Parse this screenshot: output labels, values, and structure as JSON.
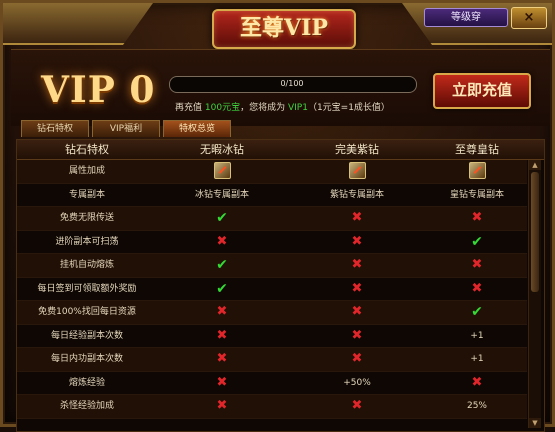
{
  "window": {
    "title": "至尊VIP",
    "level_button": "等级穿",
    "close_label": "×"
  },
  "vip": {
    "level_text": "VIP 0",
    "progress_text": "0/100",
    "progress_fraction": 0,
    "recharge_info_prefix": "再充值",
    "recharge_amount": "100元宝",
    "recharge_info_mid": "，您将成为",
    "next_vip": "VIP1",
    "recharge_info_suffix": "（1元宝=1成长值）",
    "recharge_button": "立即充值"
  },
  "tabs": [
    {
      "label": "钻石特权",
      "active": false
    },
    {
      "label": "VIP福利",
      "active": false
    },
    {
      "label": "特权总览",
      "active": true
    }
  ],
  "table": {
    "headers": [
      "钻石特权",
      "无暇冰钻",
      "完美紫钻",
      "至尊皇钻"
    ],
    "rows": [
      {
        "name": "属性加成",
        "c1": {
          "type": "gem"
        },
        "c2": {
          "type": "gem"
        },
        "c3": {
          "type": "gem"
        }
      },
      {
        "name": "专属副本",
        "c1": {
          "type": "text",
          "value": "冰钻专属副本"
        },
        "c2": {
          "type": "text",
          "value": "紫钻专属副本"
        },
        "c3": {
          "type": "text",
          "value": "皇钻专属副本"
        }
      },
      {
        "name": "免费无限传送",
        "c1": {
          "type": "check"
        },
        "c2": {
          "type": "cross"
        },
        "c3": {
          "type": "cross"
        }
      },
      {
        "name": "进阶副本可扫荡",
        "c1": {
          "type": "cross"
        },
        "c2": {
          "type": "cross"
        },
        "c3": {
          "type": "check"
        }
      },
      {
        "name": "挂机自动熔炼",
        "c1": {
          "type": "check"
        },
        "c2": {
          "type": "cross"
        },
        "c3": {
          "type": "cross"
        }
      },
      {
        "name": "每日签到可领取额外奖励",
        "c1": {
          "type": "check"
        },
        "c2": {
          "type": "cross"
        },
        "c3": {
          "type": "cross"
        }
      },
      {
        "name": "免费100%找回每日资源",
        "c1": {
          "type": "cross"
        },
        "c2": {
          "type": "cross"
        },
        "c3": {
          "type": "check"
        }
      },
      {
        "name": "每日经验副本次数",
        "c1": {
          "type": "cross"
        },
        "c2": {
          "type": "cross"
        },
        "c3": {
          "type": "text",
          "value": "+1"
        }
      },
      {
        "name": "每日内功副本次数",
        "c1": {
          "type": "cross"
        },
        "c2": {
          "type": "cross"
        },
        "c3": {
          "type": "text",
          "value": "+1"
        }
      },
      {
        "name": "熔炼经验",
        "c1": {
          "type": "cross"
        },
        "c2": {
          "type": "text",
          "value": "+50%"
        },
        "c3": {
          "type": "cross"
        }
      },
      {
        "name": "杀怪经验加成",
        "c1": {
          "type": "cross"
        },
        "c2": {
          "type": "cross"
        },
        "c3": {
          "type": "text",
          "value": "25%"
        }
      }
    ]
  },
  "colors": {
    "check": "#35d935",
    "cross": "#e0262a",
    "gold": "#ffd98a"
  },
  "icons": {
    "check": "✔",
    "cross": "✖",
    "scroll_up": "▲",
    "scroll_down": "▼"
  }
}
